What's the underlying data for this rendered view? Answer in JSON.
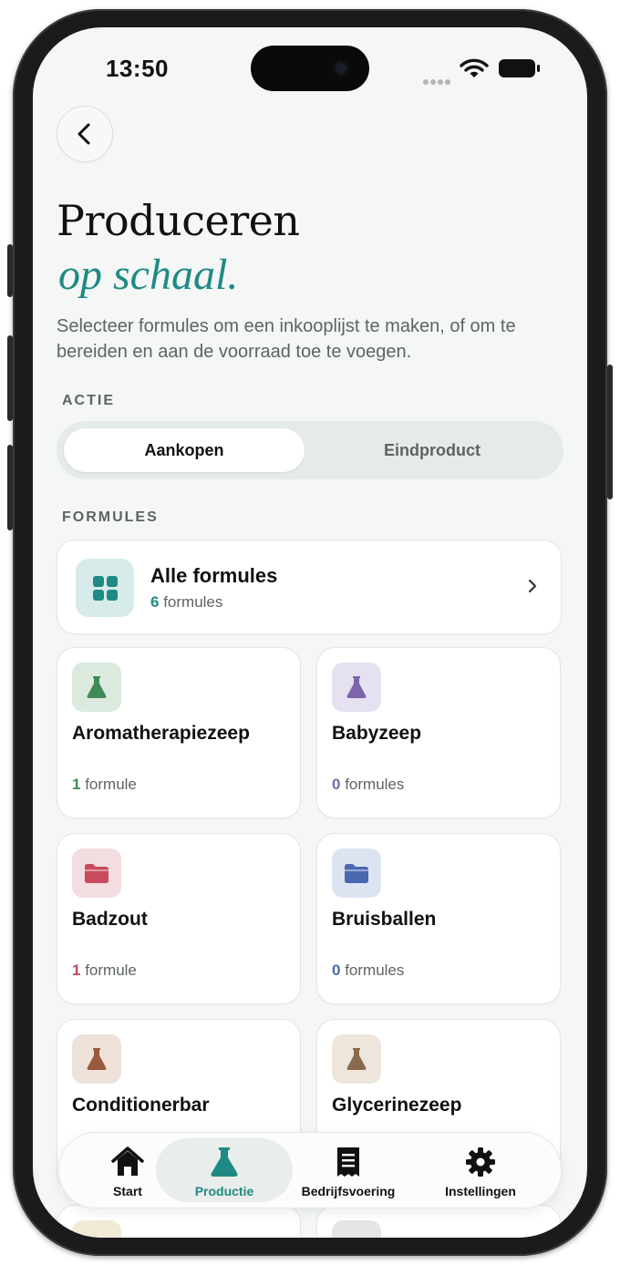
{
  "status_bar": {
    "time": "13:50"
  },
  "header": {
    "title": "Produceren",
    "title_accent": "op schaal.",
    "subtitle": "Selecteer formules om een inkooplijst te maken, of om te bereiden en aan de voorraad toe te voegen."
  },
  "action": {
    "label": "ACTIE",
    "options": [
      "Aankopen",
      "Eindproduct"
    ],
    "selected": "Aankopen"
  },
  "formulas": {
    "label": "FORMULES",
    "all": {
      "title": "Alle formules",
      "count": "6",
      "unit": "formules",
      "icon": "grid-icon"
    },
    "categories": [
      {
        "name": "Aromatherapiezeep",
        "count": "1",
        "unit": "formule",
        "icon": "flask-icon",
        "color": "#3f8a57",
        "bg": "#dbe9de"
      },
      {
        "name": "Babyzeep",
        "count": "0",
        "unit": "formules",
        "icon": "flask-icon",
        "color": "#7c65ab",
        "bg": "#e6e1f0"
      },
      {
        "name": "Badzout",
        "count": "1",
        "unit": "formule",
        "icon": "folder-icon",
        "color": "#c84a5c",
        "bg": "#f2dde0"
      },
      {
        "name": "Bruisballen",
        "count": "0",
        "unit": "formules",
        "icon": "folder-icon",
        "color": "#4a68b0",
        "bg": "#dde4f1"
      },
      {
        "name": "Conditionerbar",
        "count": "",
        "unit": "",
        "icon": "flask-icon",
        "color": "#9a5a3c",
        "bg": "#efe2da"
      },
      {
        "name": "Glycerinezeep",
        "count": "",
        "unit": "",
        "icon": "flask-icon",
        "color": "#8a6a4c",
        "bg": "#eee6dd"
      }
    ]
  },
  "tab_bar": {
    "tabs": [
      {
        "label": "Start",
        "icon": "home-icon"
      },
      {
        "label": "Productie",
        "icon": "flask-icon"
      },
      {
        "label": "Bedrijfsvoering",
        "icon": "receipt-icon"
      },
      {
        "label": "Instellingen",
        "icon": "gear-icon"
      }
    ],
    "active": "Productie"
  },
  "colors": {
    "accent": "#1f8a84",
    "background": "#f4f7f5"
  }
}
